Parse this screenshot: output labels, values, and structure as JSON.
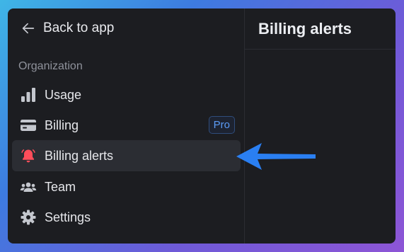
{
  "sidebar": {
    "back_label": "Back to app",
    "section_label": "Organization",
    "items": [
      {
        "label": "Usage",
        "icon": "bar-chart-icon"
      },
      {
        "label": "Billing",
        "icon": "credit-card-icon",
        "badge": "Pro"
      },
      {
        "label": "Billing alerts",
        "icon": "bell-icon",
        "active": true
      },
      {
        "label": "Team",
        "icon": "people-icon"
      },
      {
        "label": "Settings",
        "icon": "gear-icon"
      }
    ]
  },
  "main": {
    "title": "Billing alerts"
  },
  "colors": {
    "accent": "#5b9bf5",
    "alert_icon": "#ff4d5a",
    "annotation_arrow": "#2a7ff2"
  }
}
